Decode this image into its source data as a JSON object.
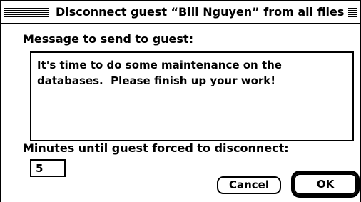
{
  "dialog": {
    "title": "Disconnect guest “Bill Nguyen” from all files",
    "message_label": "Message to send to guest:",
    "message_value": "It's time to do some maintenance on the\ndatabases.  Please finish up your work!",
    "minutes_label": "Minutes until guest forced to disconnect:",
    "minutes_value": "5",
    "cancel_label": "Cancel",
    "ok_label": "OK"
  }
}
